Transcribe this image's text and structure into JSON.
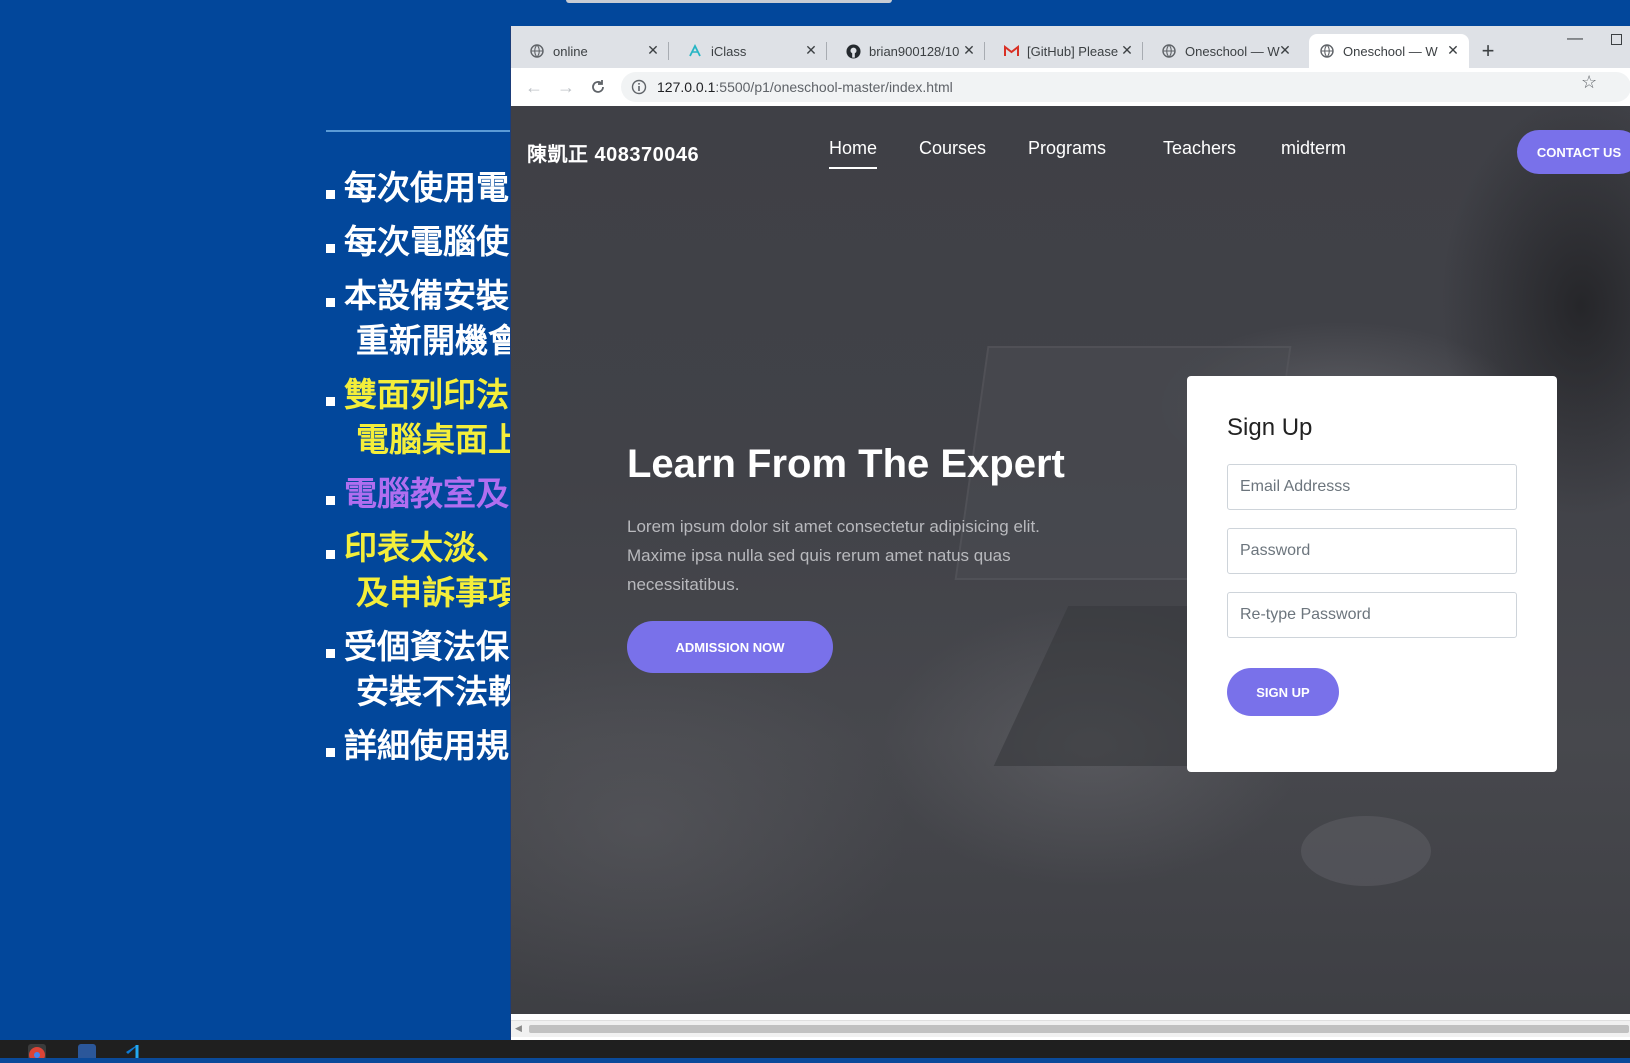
{
  "slide": {
    "bullets": [
      {
        "lines": [
          "每次使用電"
        ],
        "color": "white"
      },
      {
        "lines": [
          "每次電腦使"
        ],
        "color": "white"
      },
      {
        "lines": [
          "本設備安裝",
          "重新開機會"
        ],
        "color": "white"
      },
      {
        "lines": [
          "雙面列印法",
          "電腦桌面上"
        ],
        "color": "yellow"
      },
      {
        "lines": [
          "電腦教室及"
        ],
        "color": "purple"
      },
      {
        "lines": [
          "印表太淡、",
          "及申訴事項"
        ],
        "color": "yellow"
      },
      {
        "lines": [
          "受個資法保",
          "安裝不法軟"
        ],
        "color": "white"
      },
      {
        "lines": [
          "詳細使用規"
        ],
        "color": "white"
      }
    ]
  },
  "browser": {
    "tabs": [
      {
        "title": "online",
        "icon": "globe-icon"
      },
      {
        "title": "iClass",
        "icon": "iclass-icon"
      },
      {
        "title": "brian900128/10",
        "icon": "github-icon"
      },
      {
        "title": "[GitHub] Please",
        "icon": "gmail-icon"
      },
      {
        "title": "Oneschool — W",
        "icon": "globe-icon"
      },
      {
        "title": "Oneschool — W",
        "icon": "globe-icon",
        "active": true
      }
    ],
    "url_host": "127.0.0.1",
    "url_rest": ":5500/p1/oneschool-master/index.html"
  },
  "site": {
    "brand": "陳凱正 408370046",
    "menu": [
      "Home",
      "Courses",
      "Programs",
      "Teachers",
      "midterm"
    ],
    "contact_label": "CONTACT US",
    "hero_title": "Learn From The Expert",
    "hero_text": "Lorem ipsum dolor sit amet consectetur adipisicing elit. Maxime ipsa nulla sed quis rerum amet natus quas necessitatibus.",
    "admission_label": "ADMISSION NOW",
    "signup": {
      "title": "Sign Up",
      "email_placeholder": "Email Addresss",
      "password_placeholder": "Password",
      "retype_placeholder": "Re-type Password",
      "button_label": "SIGN UP"
    }
  },
  "colors": {
    "accent": "#7971ea",
    "slide_bg": "#02479b",
    "slide_yellow": "#f4ee3a",
    "slide_purple": "#b06ef0"
  }
}
